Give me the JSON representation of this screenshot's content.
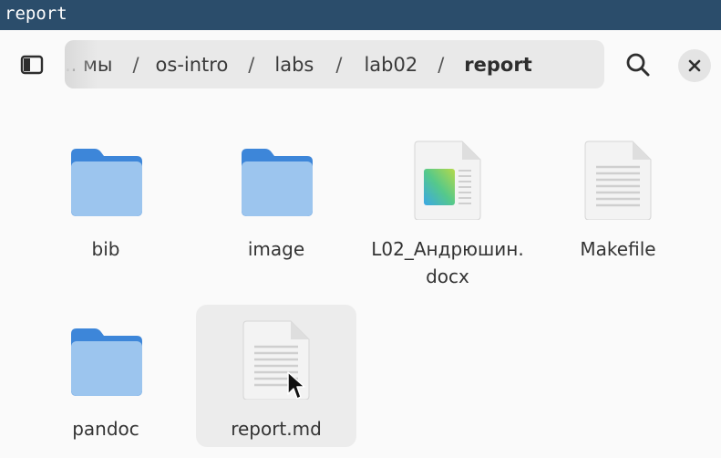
{
  "window": {
    "title": "report"
  },
  "pathbar": {
    "crumbs": [
      {
        "label": ".. мы",
        "current": false
      },
      {
        "label": "os-intro",
        "current": false
      },
      {
        "label": "labs",
        "current": false
      },
      {
        "label": "lab02",
        "current": false
      },
      {
        "label": "report",
        "current": true
      }
    ],
    "separator": "/"
  },
  "toolbar": {
    "sidebar_icon": "sidebar-toggle-icon",
    "menu_icon": "vertical-ellipsis-icon",
    "search_icon": "search-icon",
    "close_icon": "close-icon"
  },
  "files": [
    {
      "name": "bib",
      "type": "folder"
    },
    {
      "name": "image",
      "type": "folder"
    },
    {
      "name": "L02_Андрюшин.docx",
      "type": "document"
    },
    {
      "name": "Makefile",
      "type": "text"
    },
    {
      "name": "pandoc",
      "type": "folder"
    },
    {
      "name": "report.md",
      "type": "text",
      "hovered": true
    }
  ],
  "colors": {
    "titlebar": "#2b4d6b",
    "folder_back": "#3d86d9",
    "folder_front": "#9cc5ee"
  }
}
